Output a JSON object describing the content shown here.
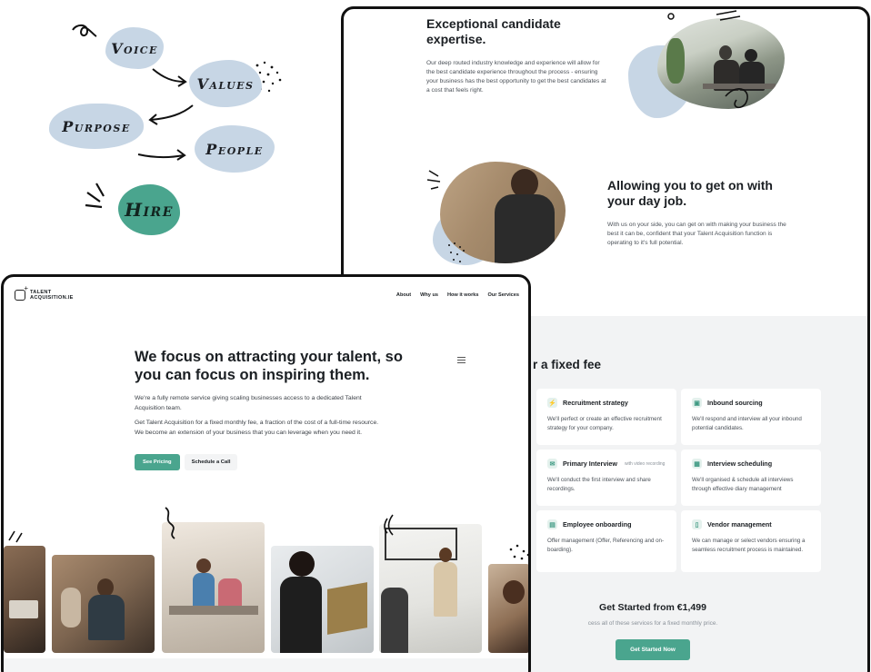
{
  "sketch": {
    "voice": "Voice",
    "values": "Values",
    "purpose": "Purpose",
    "people": "People",
    "hire": "Hire"
  },
  "right_window": {
    "feature1": {
      "title": "Exceptional candidate expertise.",
      "body": "Our deep routed industry knowledge and experience will allow for the best candidate experience throughout the process - ensuring your business has the best opportunity to get the best candidates at a cost that feels right."
    },
    "feature2": {
      "title": "Allowing you to get on with your day job.",
      "body": "With us on your side, you can get on with making your business the best it can be, confident that your Talent Acquisition function is operating to it's full potential."
    },
    "services": {
      "title_partial": "r a fixed fee",
      "cards": [
        {
          "title": "Recruitment strategy",
          "tag": "",
          "icon": "lightning-icon",
          "body": "We'll perfect or create an effective recruitment strategy for your company."
        },
        {
          "title": "Inbound sourcing",
          "tag": "",
          "icon": "inbox-icon",
          "body": "We'll respond and interview all your inbound potential candidates."
        },
        {
          "title": "Primary Interview",
          "tag": "with video recording",
          "icon": "chat-icon",
          "body": "We'll conduct the first interview and share recordings."
        },
        {
          "title": "Interview scheduling",
          "tag": "",
          "icon": "calendar-icon",
          "body": "We'll organised & schedule all interviews through effective diary management"
        },
        {
          "title": "Employee onboarding",
          "tag": "",
          "icon": "book-icon",
          "body": "Offer management (Offer, Referencing and on-boarding)."
        },
        {
          "title": "Vendor management",
          "tag": "",
          "icon": "document-icon",
          "body": "We can manage or select vendors ensuring a seamless recruitment process is maintained."
        }
      ]
    },
    "pricing": {
      "title": "Get Started from €1,499",
      "subtitle_partial": "cess all of these services for a fixed monthly price.",
      "cta": "Get Started Now"
    }
  },
  "left_window": {
    "logo": "TALENT ACQUISITION.IE",
    "nav": [
      "About",
      "Why us",
      "How it works",
      "Our Services"
    ],
    "hero": {
      "title": "We focus on attracting your talent, so you can focus on inspiring them.",
      "para1": "We're a fully remote service giving scaling businesses access to a dedicated Talent Acquisition team.",
      "para2": "Get Talent Acquisition for a fixed monthly fee, a fraction of the cost of a full-time resource. We become an extension of your business that you can leverage when you need it.",
      "primary_cta": "See Pricing",
      "secondary_cta": "Schedule a Call"
    }
  },
  "colors": {
    "accent_green": "#4aa58e",
    "blob_blue": "#c7d6e5",
    "panel_gray": "#f2f3f4"
  }
}
